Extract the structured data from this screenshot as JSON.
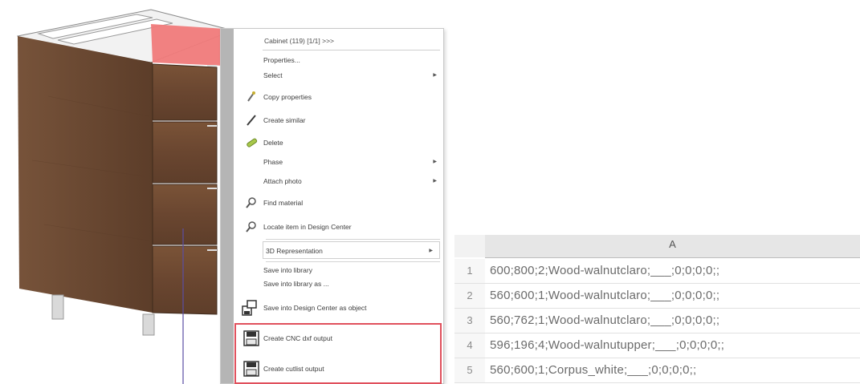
{
  "context_menu": {
    "title": "Cabinet (119) [1/1] >>>",
    "items": [
      {
        "label": "Properties...",
        "icon": "",
        "submenu": false
      },
      {
        "label": "Select",
        "icon": "",
        "submenu": true
      },
      {
        "label": "Copy properties",
        "icon": "paint-brush-icon",
        "submenu": false
      },
      {
        "label": "Create similar",
        "icon": "pencil-icon",
        "submenu": false
      },
      {
        "label": "Delete",
        "icon": "eraser-icon",
        "submenu": false
      },
      {
        "label": "Phase",
        "icon": "",
        "submenu": true
      },
      {
        "label": "Attach photo",
        "icon": "",
        "submenu": true
      },
      {
        "label": "Find material",
        "icon": "magnifier-icon",
        "submenu": false
      },
      {
        "label": "Locate item in Design Center",
        "icon": "magnifier-icon",
        "submenu": false
      },
      {
        "label": "3D Representation",
        "icon": "",
        "submenu": true
      },
      {
        "label": "Save into library",
        "icon": "",
        "submenu": false
      },
      {
        "label": "Save into library as ...",
        "icon": "",
        "submenu": false
      },
      {
        "label": "Save into Design Center as object",
        "icon": "save-to-design-center-icon",
        "submenu": false
      },
      {
        "label": "Create CNC dxf output",
        "icon": "floppy-disk-icon",
        "submenu": false
      },
      {
        "label": "Create cutlist output",
        "icon": "floppy-disk-icon",
        "submenu": false
      }
    ],
    "highlight_color": "#e0505c"
  },
  "spreadsheet": {
    "column_header": "A",
    "rows": [
      {
        "num": "1",
        "value": "600;800;2;Wood-walnutclaro;___;0;0;0;0;;"
      },
      {
        "num": "2",
        "value": "560;600;1;Wood-walnutclaro;___;0;0;0;0;;"
      },
      {
        "num": "3",
        "value": "560;762;1;Wood-walnutclaro;___;0;0;0;0;;"
      },
      {
        "num": "4",
        "value": "596;196;4;Wood-walnutupper;___;0;0;0;0;;"
      },
      {
        "num": "5",
        "value": "560;600;1;Corpus_white;___;0;0;0;0;;"
      }
    ]
  },
  "colors": {
    "wood": "#6d4a32",
    "selection_face": "#f08080",
    "selection_line": "#5b4ea3"
  }
}
